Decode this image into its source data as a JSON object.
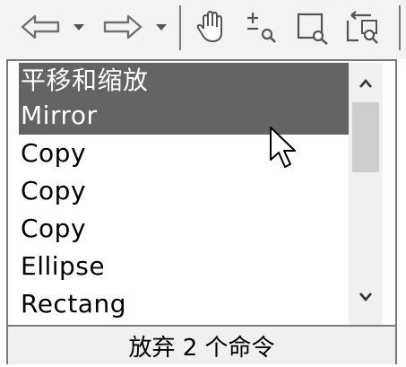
{
  "toolbar": {
    "icons": [
      "undo-icon",
      "dropdown-arrow-icon",
      "redo-icon",
      "dropdown-arrow-icon",
      "pan-hand-icon",
      "zoom-realtime-icon",
      "zoom-window-icon",
      "zoom-previous-icon"
    ]
  },
  "history_list": {
    "items": [
      {
        "label": "平移和缩放",
        "selected": true
      },
      {
        "label": "Mirror",
        "selected": true
      },
      {
        "label": "Copy",
        "selected": false
      },
      {
        "label": "Copy",
        "selected": false
      },
      {
        "label": "Copy",
        "selected": false
      },
      {
        "label": "Ellipse",
        "selected": false
      },
      {
        "label": "Rectang",
        "selected": false
      }
    ]
  },
  "footer": {
    "status": "放弃 2 个命令"
  },
  "colors": {
    "selection": "#646464",
    "border": "#7a7a7a",
    "toolbar_bg": "#f3f3f3"
  }
}
